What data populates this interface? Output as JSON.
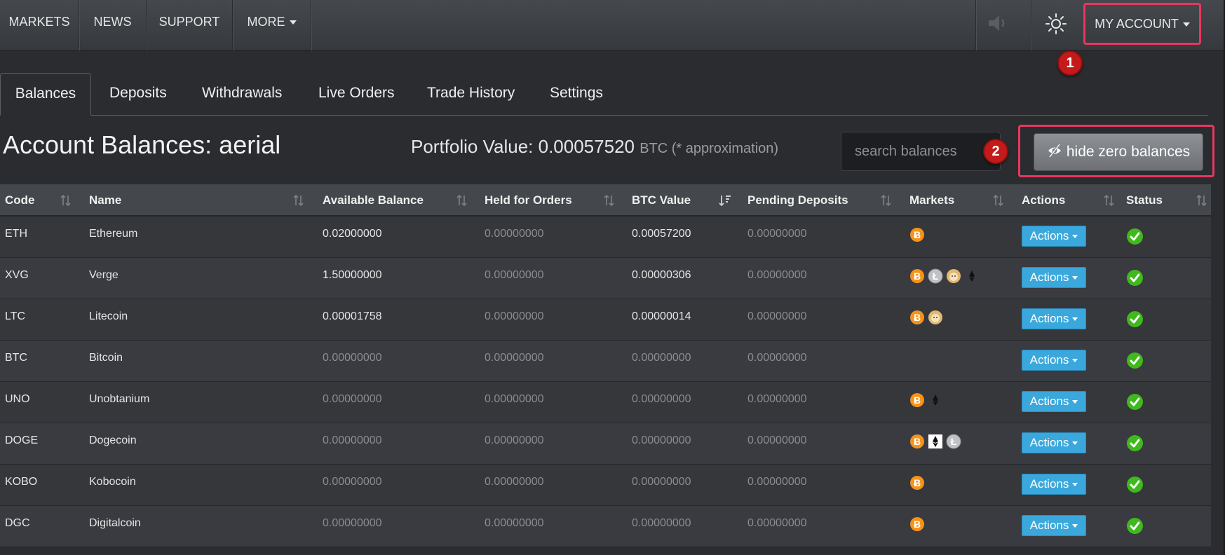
{
  "nav": {
    "markets": "MARKETS",
    "news": "NEWS",
    "support": "SUPPORT",
    "more": "MORE",
    "my_account": "MY ACCOUNT"
  },
  "annotations": {
    "badge1": "1",
    "badge2": "2"
  },
  "tabs": [
    "Balances",
    "Deposits",
    "Withdrawals",
    "Live Orders",
    "Trade History",
    "Settings"
  ],
  "header": {
    "title": "Account Balances: aerial",
    "portfolio_label": "Portfolio Value: 0.00057520",
    "portfolio_unit": "BTC (* approximation)",
    "search_placeholder": "search balances",
    "hide_zero_label": "hide zero balances"
  },
  "table": {
    "columns": [
      "Code",
      "Name",
      "Available Balance",
      "Held for Orders",
      "BTC Value",
      "Pending Deposits",
      "Markets",
      "Actions",
      "Status"
    ],
    "action_label": "Actions",
    "rows": [
      {
        "code": "ETH",
        "name": "Ethereum",
        "available": "0.02000000",
        "held": "0.00000000",
        "btc": "0.00057200",
        "pending": "0.00000000",
        "markets": [
          "btc"
        ]
      },
      {
        "code": "XVG",
        "name": "Verge",
        "available": "1.50000000",
        "held": "0.00000000",
        "btc": "0.00000306",
        "pending": "0.00000000",
        "markets": [
          "btc",
          "ltc",
          "doge",
          "eth"
        ]
      },
      {
        "code": "LTC",
        "name": "Litecoin",
        "available": "0.00001758",
        "held": "0.00000000",
        "btc": "0.00000014",
        "pending": "0.00000000",
        "markets": [
          "btc",
          "doge"
        ]
      },
      {
        "code": "BTC",
        "name": "Bitcoin",
        "available": "0.00000000",
        "held": "0.00000000",
        "btc": "0.00000000",
        "pending": "0.00000000",
        "markets": []
      },
      {
        "code": "UNO",
        "name": "Unobtanium",
        "available": "0.00000000",
        "held": "0.00000000",
        "btc": "0.00000000",
        "pending": "0.00000000",
        "markets": [
          "btc",
          "eth"
        ]
      },
      {
        "code": "DOGE",
        "name": "Dogecoin",
        "available": "0.00000000",
        "held": "0.00000000",
        "btc": "0.00000000",
        "pending": "0.00000000",
        "markets": [
          "btc",
          "eth-white",
          "ltc"
        ]
      },
      {
        "code": "KOBO",
        "name": "Kobocoin",
        "available": "0.00000000",
        "held": "0.00000000",
        "btc": "0.00000000",
        "pending": "0.00000000",
        "markets": [
          "btc"
        ]
      },
      {
        "code": "DGC",
        "name": "Digitalcoin",
        "available": "0.00000000",
        "held": "0.00000000",
        "btc": "0.00000000",
        "pending": "0.00000000",
        "markets": [
          "btc"
        ]
      }
    ]
  },
  "colors": {
    "accent_highlight": "#e8375f",
    "actions_button": "#3aa8dc",
    "status_ok": "#3fb91b",
    "btc_orange": "#f7931a"
  }
}
